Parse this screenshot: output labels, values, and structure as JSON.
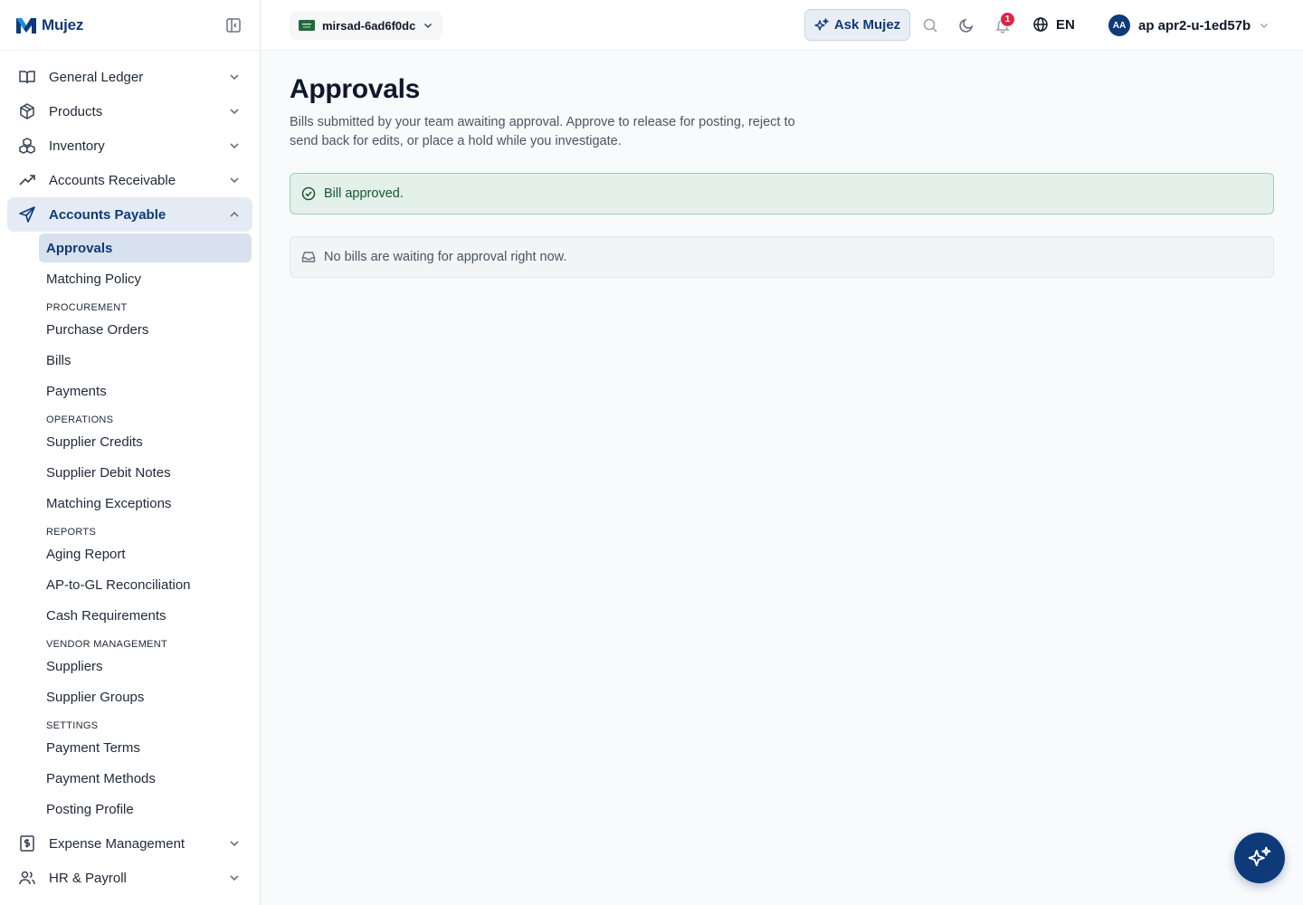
{
  "brand": {
    "name": "Mujez"
  },
  "sidebar": {
    "groups_top": [
      {
        "label": "General Ledger",
        "icon": "book-open-icon"
      },
      {
        "label": "Products",
        "icon": "package-icon"
      },
      {
        "label": "Inventory",
        "icon": "boxes-icon"
      },
      {
        "label": "Accounts Receivable",
        "icon": "trending-up-icon"
      }
    ],
    "active_group": {
      "label": "Accounts Payable",
      "icon": "send-icon"
    },
    "sub": {
      "approvals": "Approvals",
      "matching_policy": "Matching Policy",
      "procurement_section": "PROCUREMENT",
      "purchase_orders": "Purchase Orders",
      "bills": "Bills",
      "payments": "Payments",
      "operations_section": "OPERATIONS",
      "supplier_credits": "Supplier Credits",
      "supplier_debit_notes": "Supplier Debit Notes",
      "matching_exceptions": "Matching Exceptions",
      "reports_section": "REPORTS",
      "aging_report": "Aging Report",
      "ap_gl_recon": "AP-to-GL Reconciliation",
      "cash_requirements": "Cash Requirements",
      "vendor_section": "VENDOR MANAGEMENT",
      "suppliers": "Suppliers",
      "supplier_groups": "Supplier Groups",
      "settings_section": "SETTINGS",
      "payment_terms": "Payment Terms",
      "payment_methods": "Payment Methods",
      "posting_profile": "Posting Profile"
    },
    "groups_bottom": [
      {
        "label": "Expense Management",
        "icon": "receipt-dollar-icon"
      },
      {
        "label": "HR & Payroll",
        "icon": "users-icon"
      }
    ]
  },
  "topbar": {
    "org_name": "mirsad-6ad6f0dc",
    "ask_label": "Ask Mujez",
    "notification_count": "1",
    "language": "EN",
    "user_initials": "AA",
    "user_name": "ap apr2-u-1ed57b"
  },
  "page": {
    "title": "Approvals",
    "description": "Bills submitted by your team awaiting approval. Approve to release for posting, reject to send back for edits, or place a hold while you investigate.",
    "alert": "Bill approved.",
    "empty": "No bills are waiting for approval right now."
  },
  "colors": {
    "brand": "#0f3a7a",
    "success_bg": "#e3f1ea",
    "badge": "#dc2646"
  }
}
